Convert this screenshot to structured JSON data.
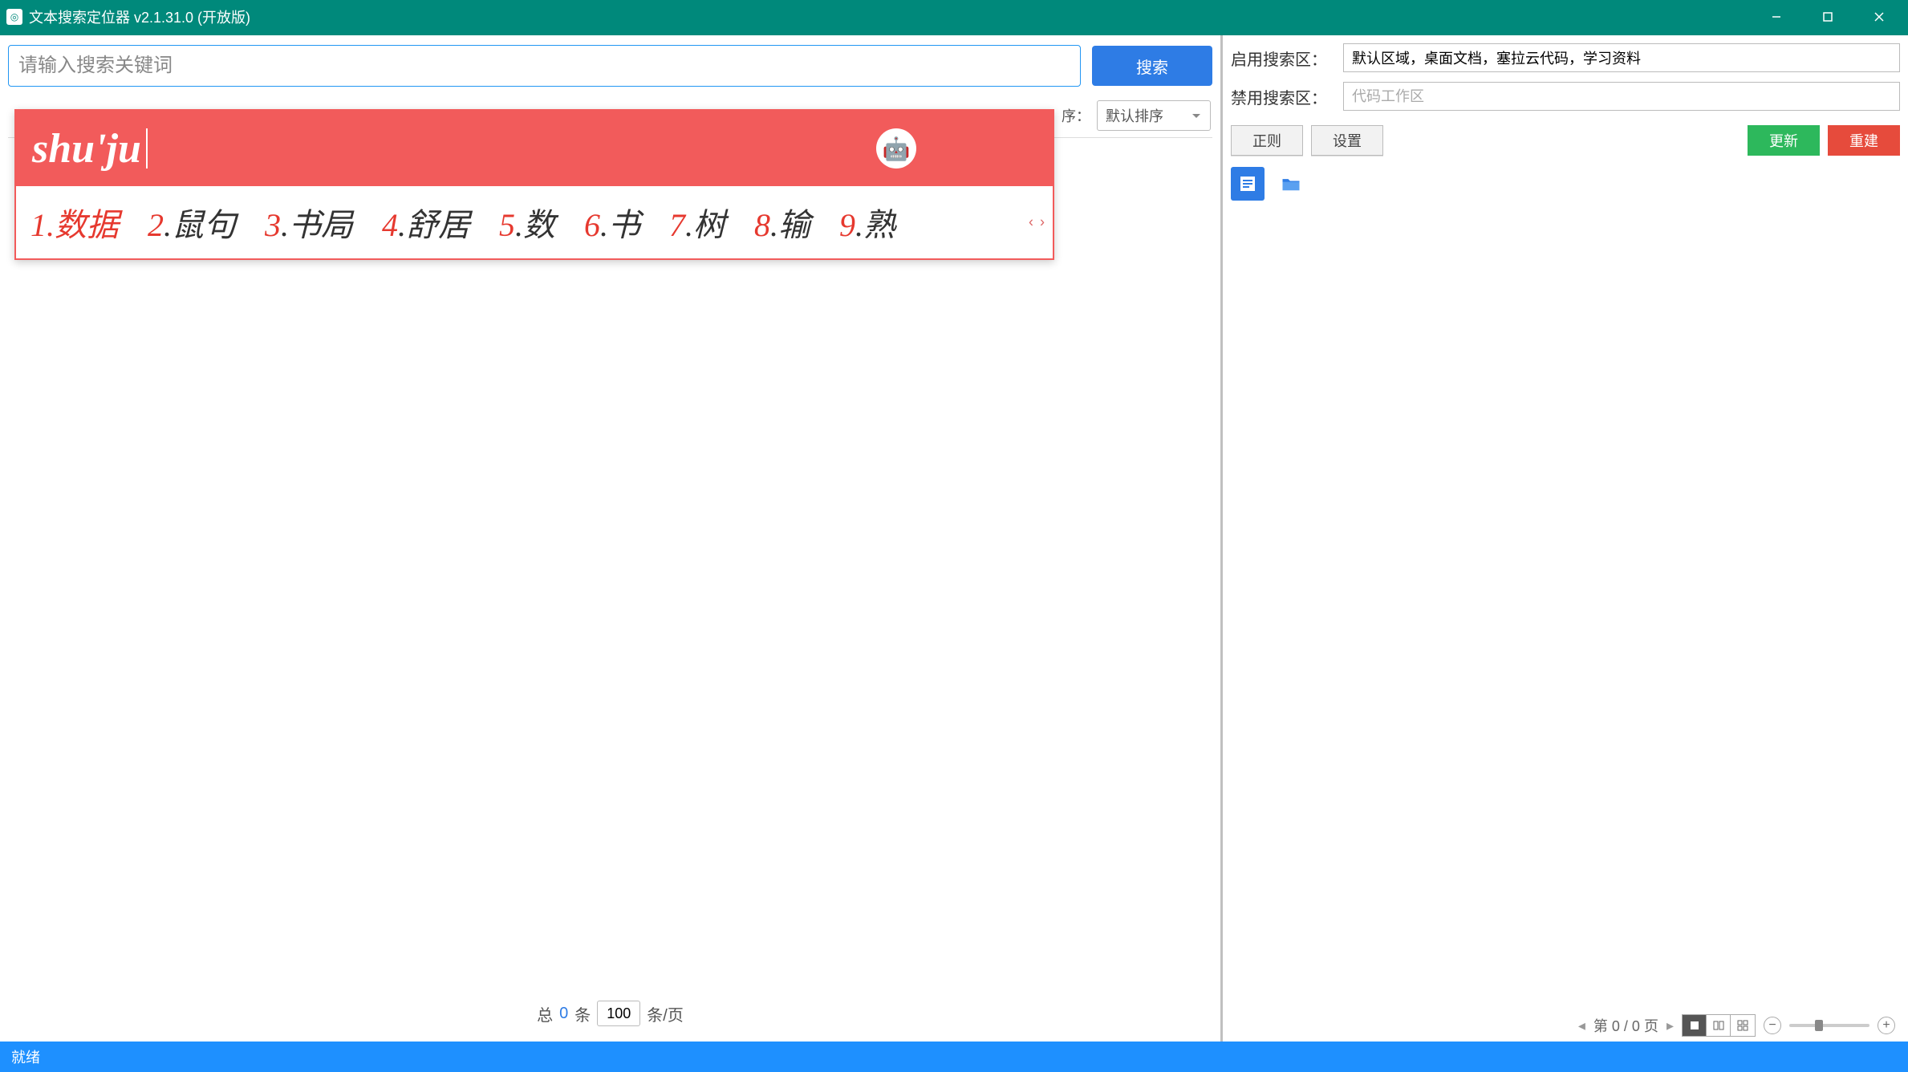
{
  "title": "文本搜索定位器 v2.1.31.0 (开放版)",
  "search": {
    "placeholder": "请输入搜索关键词",
    "button": "搜索"
  },
  "sort": {
    "label": "序：",
    "value": "默认排序"
  },
  "pagination": {
    "total_prefix": "总",
    "count": "0",
    "total_suffix": "条",
    "page_size": "100",
    "page_size_suffix": "条/页"
  },
  "right": {
    "enable_label": "启用搜索区：",
    "enable_value": "默认区域，桌面文档，塞拉云代码，学习资料",
    "disable_label": "禁用搜索区：",
    "disable_placeholder": "代码工作区",
    "btn_regex": "正则",
    "btn_settings": "设置",
    "btn_update": "更新",
    "btn_rebuild": "重建"
  },
  "preview_footer": {
    "page_info": "第 0 / 0 页"
  },
  "status": "就绪",
  "ime": {
    "pinyin": "shu'ju",
    "candidates": [
      {
        "n": "1",
        "t": "数据"
      },
      {
        "n": "2",
        "t": "鼠句"
      },
      {
        "n": "3",
        "t": "书局"
      },
      {
        "n": "4",
        "t": "舒居"
      },
      {
        "n": "5",
        "t": "数"
      },
      {
        "n": "6",
        "t": "书"
      },
      {
        "n": "7",
        "t": "树"
      },
      {
        "n": "8",
        "t": "输"
      },
      {
        "n": "9",
        "t": "熟"
      }
    ]
  }
}
